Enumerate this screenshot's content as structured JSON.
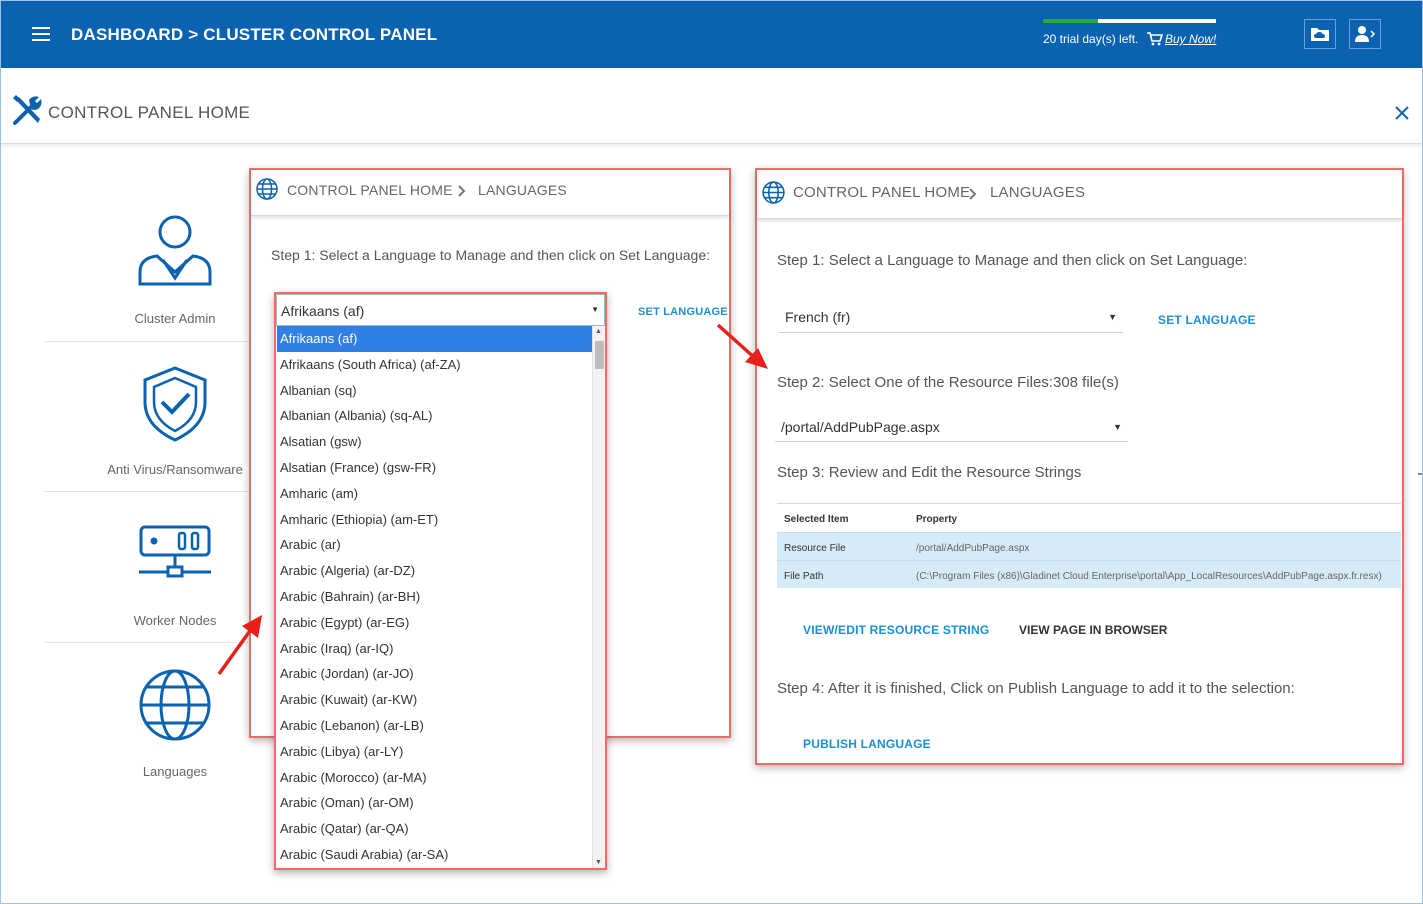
{
  "header": {
    "breadcrumb": "DASHBOARD > CLUSTER CONTROL PANEL",
    "trial_text": "20 trial day(s) left.",
    "trial_progress": 0.32,
    "buy_now": "Buy Now!",
    "accent": "#0b62b1"
  },
  "page": {
    "title": "CONTROL PANEL HOME"
  },
  "sidebar": {
    "items": [
      {
        "label": "Cluster Admin",
        "icon": "user-admin-icon"
      },
      {
        "label": "Anti Virus/Ransomware",
        "icon": "shield-check-icon"
      },
      {
        "label": "Worker Nodes",
        "icon": "server-node-icon"
      },
      {
        "label": "Languages",
        "icon": "globe-icon"
      }
    ]
  },
  "left_panel": {
    "crumb_home": "CONTROL PANEL HOME",
    "crumb_current": "LANGUAGES",
    "step1": "Step 1: Select a Language to Manage and then click on Set Language:",
    "selected_language": "Afrikaans (af)",
    "set_language": "SET LANGUAGE",
    "options": [
      "Afrikaans (af)",
      "Afrikaans (South Africa) (af-ZA)",
      "Albanian (sq)",
      "Albanian (Albania) (sq-AL)",
      "Alsatian (gsw)",
      "Alsatian (France) (gsw-FR)",
      "Amharic (am)",
      "Amharic (Ethiopia) (am-ET)",
      "Arabic (ar)",
      "Arabic (Algeria) (ar-DZ)",
      "Arabic (Bahrain) (ar-BH)",
      "Arabic (Egypt) (ar-EG)",
      "Arabic (Iraq) (ar-IQ)",
      "Arabic (Jordan) (ar-JO)",
      "Arabic (Kuwait) (ar-KW)",
      "Arabic (Lebanon) (ar-LB)",
      "Arabic (Libya) (ar-LY)",
      "Arabic (Morocco) (ar-MA)",
      "Arabic (Oman) (ar-OM)",
      "Arabic (Qatar) (ar-QA)",
      "Arabic (Saudi Arabia) (ar-SA)"
    ]
  },
  "right_panel": {
    "crumb_home": "CONTROL PANEL HOME",
    "crumb_current": "LANGUAGES",
    "step1": "Step 1: Select a Language to Manage and then click on Set Language:",
    "selected_language": "French (fr)",
    "set_language": "SET LANGUAGE",
    "step2": "Step 2: Select One of the Resource Files:308 file(s)",
    "selected_file": "/portal/AddPubPage.aspx",
    "step3": "Step 3: Review and Edit the Resource Strings",
    "table": {
      "headers": [
        "Selected Item",
        "Property"
      ],
      "rows": [
        [
          "Resource File",
          "/portal/AddPubPage.aspx"
        ],
        [
          "File Path",
          "(C:\\Program Files (x86)\\Gladinet Cloud Enterprise\\portal\\App_LocalResources\\AddPubPage.aspx.fr.resx)"
        ]
      ]
    },
    "view_edit": "VIEW/EDIT RESOURCE STRING",
    "view_page": "VIEW PAGE IN BROWSER",
    "step4": "Step 4: After it is finished, Click on Publish Language to add it to the selection:",
    "publish": "PUBLISH LANGUAGE"
  },
  "colors": {
    "highlight_border": "#f06a6a",
    "link_blue": "#1b8fd6",
    "selected_item": "#2f7fe5",
    "arrow_red": "#e8201b"
  }
}
